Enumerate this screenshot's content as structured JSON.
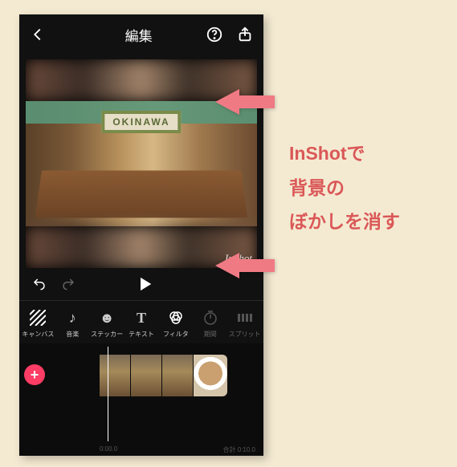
{
  "header": {
    "title": "編集"
  },
  "preview": {
    "sign_text": "OKINAWA",
    "watermark": "InShot"
  },
  "tools": [
    {
      "label": "キャンバス",
      "icon": "hatch"
    },
    {
      "label": "音楽",
      "icon": "note"
    },
    {
      "label": "ステッカー",
      "icon": "smile"
    },
    {
      "label": "テキスト",
      "icon": "text"
    },
    {
      "label": "フィルタ",
      "icon": "filter"
    },
    {
      "label": "期間",
      "icon": "duration",
      "dim": true
    },
    {
      "label": "スプリット",
      "icon": "split",
      "dim": true
    }
  ],
  "timeline": {
    "start": "0:00.0",
    "end": "合計 0:10.0"
  },
  "callout": {
    "line1": "InShotで",
    "line2": "背景の",
    "line3": "ぼかしを消す"
  }
}
